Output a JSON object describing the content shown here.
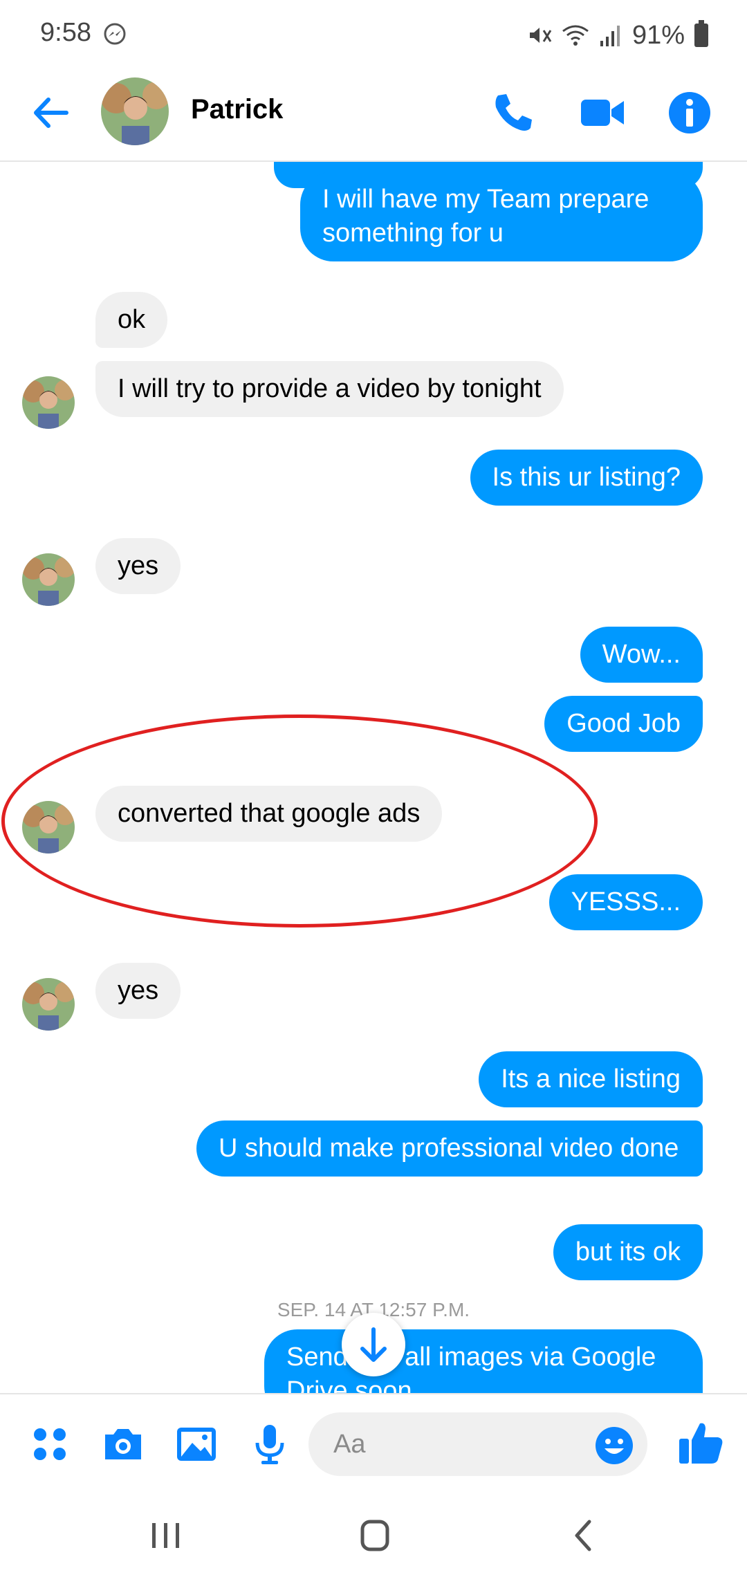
{
  "status_bar": {
    "time": "9:58",
    "battery": "91%"
  },
  "header": {
    "contact_name": "Patrick"
  },
  "messages": [
    {
      "from": "me",
      "text": "I will have my Team prepare something for u"
    },
    {
      "from": "them",
      "text": "ok"
    },
    {
      "from": "them",
      "text": "I will try to provide a video by tonight"
    },
    {
      "from": "me",
      "text": "Is this ur listing?"
    },
    {
      "from": "them",
      "text": "yes"
    },
    {
      "from": "me",
      "text": "Wow..."
    },
    {
      "from": "me",
      "text": "Good Job"
    },
    {
      "from": "them",
      "text": "converted that google ads"
    },
    {
      "from": "me",
      "text": "YESSS..."
    },
    {
      "from": "them",
      "text": "yes"
    },
    {
      "from": "me",
      "text": "Its a nice listing"
    },
    {
      "from": "me",
      "text": "U should make professional video done"
    },
    {
      "from": "me",
      "text": "but its ok"
    },
    {
      "from": "me",
      "text": "Send you all images via Google Drive soon"
    }
  ],
  "timestamp": "SEP. 14 AT 12:57 P.M.",
  "composer": {
    "placeholder": "Aa"
  },
  "colors": {
    "accent": "#0099ff",
    "incoming_bubble": "#f0f0f0",
    "highlight_ring": "#e02020"
  },
  "icons": [
    "messenger-icon",
    "mute-icon",
    "wifi-icon",
    "signal-icon",
    "battery-icon",
    "back-arrow-icon",
    "phone-icon",
    "video-camera-icon",
    "info-icon",
    "scroll-down-arrow-icon",
    "apps-grid-icon",
    "camera-icon",
    "gallery-icon",
    "microphone-icon",
    "emoji-icon",
    "thumbs-up-icon",
    "recent-apps-icon",
    "home-icon",
    "back-icon"
  ]
}
